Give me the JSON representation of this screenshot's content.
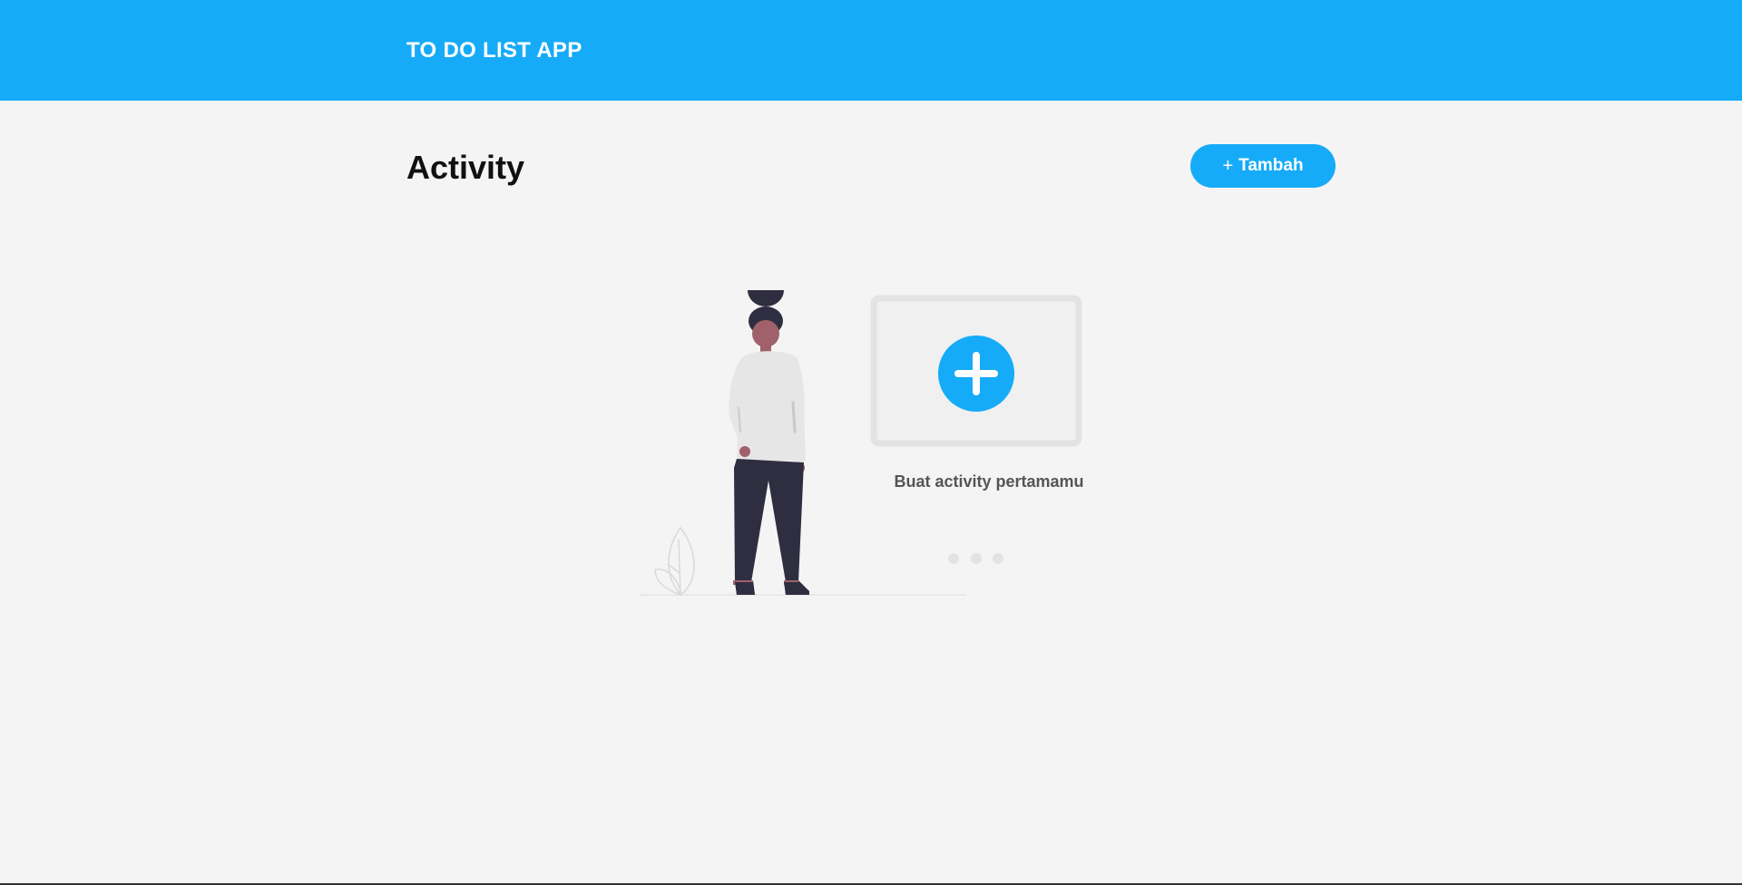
{
  "header": {
    "title": "TO DO LIST APP"
  },
  "main": {
    "title": "Activity",
    "add_button": {
      "icon": "plus-icon",
      "icon_glyph": "+",
      "label": "Tambah"
    }
  },
  "empty_state": {
    "message": "Buat activity pertamamu",
    "illustration_icons": [
      "person-illustration",
      "plus-circle-icon",
      "leaf-icon",
      "dots-indicator"
    ]
  },
  "colors": {
    "primary": "#16abf8",
    "background": "#f4f4f4",
    "title_text": "#111111",
    "empty_text": "#555555"
  }
}
